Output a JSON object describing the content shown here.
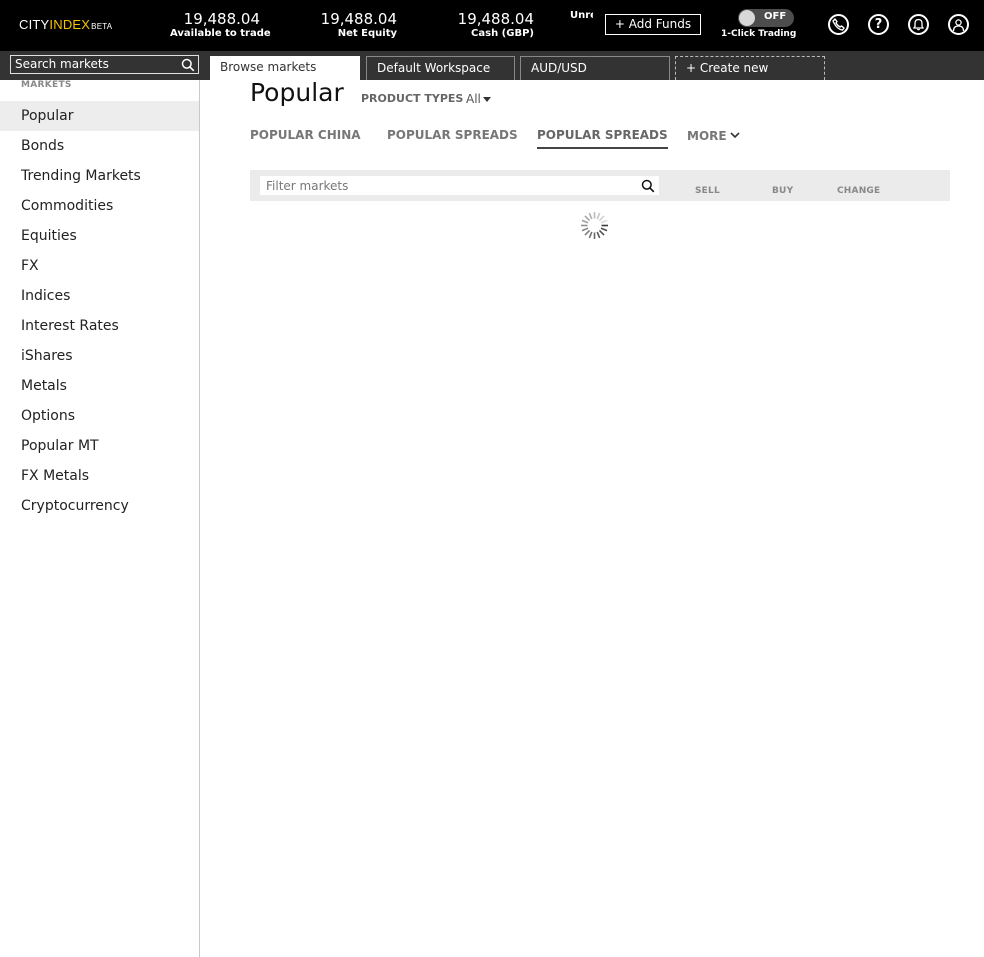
{
  "header": {
    "logo_city": "CITY",
    "logo_index": "INDEX",
    "logo_beta": "BETA",
    "stats": [
      {
        "value": "19,488.04",
        "label": "Available to trade"
      },
      {
        "value": "19,488.04",
        "label": "Net Equity"
      },
      {
        "value": "19,488.04",
        "label": "Cash (GBP)"
      },
      {
        "value": "",
        "label": "Unre"
      }
    ],
    "add_funds_label": "+ Add Funds",
    "one_click": {
      "state": "OFF",
      "label": "1-Click Trading"
    },
    "icons": [
      "phone-icon",
      "help-icon",
      "bell-icon",
      "user-icon"
    ]
  },
  "toolbar": {
    "search_placeholder": "Search markets",
    "tabs": [
      {
        "label": "Browse markets",
        "active": true
      },
      {
        "label": "Default Workspace",
        "active": false
      },
      {
        "label": "AUD/USD",
        "active": false
      },
      {
        "label": "+ Create new",
        "active": false
      }
    ]
  },
  "sidebar": {
    "heading": "MARKETS",
    "items": [
      {
        "label": "Popular",
        "active": true
      },
      {
        "label": "Bonds"
      },
      {
        "label": "Trending Markets"
      },
      {
        "label": "Commodities"
      },
      {
        "label": "Equities"
      },
      {
        "label": "FX"
      },
      {
        "label": "Indices"
      },
      {
        "label": "Interest Rates"
      },
      {
        "label": "iShares"
      },
      {
        "label": "Metals"
      },
      {
        "label": "Options"
      },
      {
        "label": "Popular MT"
      },
      {
        "label": "FX Metals"
      },
      {
        "label": "Cryptocurrency"
      }
    ]
  },
  "main": {
    "title": "Popular",
    "product_types_label": "PRODUCT TYPES",
    "product_types_value": "All",
    "subtabs": [
      {
        "label": "POPULAR CHINA",
        "active": false
      },
      {
        "label": "POPULAR SPREADS",
        "active": false
      },
      {
        "label": "POPULAR SPREADS",
        "active": true
      },
      {
        "label": "MORE",
        "active": false
      }
    ],
    "filter_placeholder": "Filter markets",
    "columns": [
      "SELL",
      "BUY",
      "CHANGE"
    ],
    "loading": true
  },
  "colors": {
    "topbar_bg": "#000000",
    "secbar_bg": "#333333",
    "logo_accent": "#f5c400",
    "active_item_bg": "#ededed"
  }
}
